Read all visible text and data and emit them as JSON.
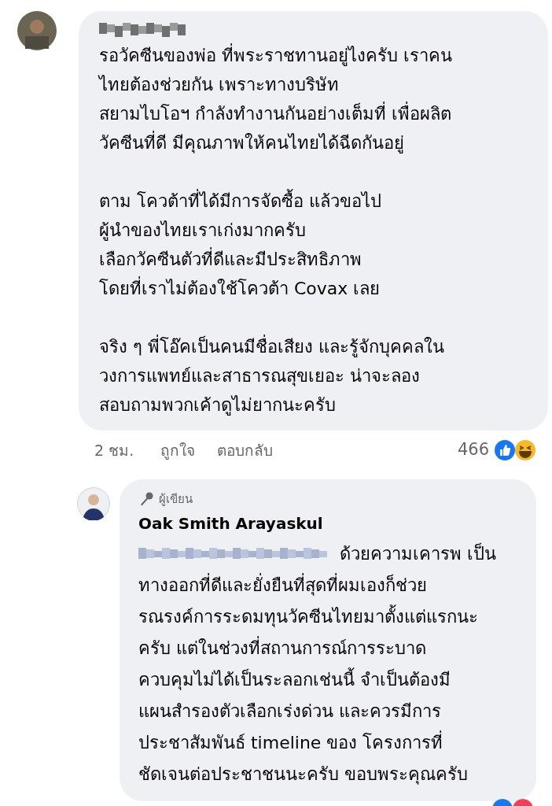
{
  "comment": {
    "paragraphs": [
      [
        "รอวัคซีนของพ่อ ที่พระราชทานอยู่ไงครับ เราคน",
        "ไทยต้องช่วยกัน เพราะทางบริษัท",
        "สยามไบโอฯ กำลังทำงานกันอย่างเต็มที่ เพื่อผลิต",
        "วัคซีนที่ดี มีคุณภาพให้คนไทยได้ฉีดกันอยู่"
      ],
      [
        "ตาม โควต้าที่ได้มีการจัดซื้อ แล้วขอไป",
        "ผู้นำของไทยเราเก่งมากครับ",
        "เลือกวัคซีนตัวที่ดีและมีประสิทธิภาพ",
        "โดยที่เราไม่ต้องใช้โควต้า Covax เลย"
      ],
      [
        "จริง ๆ พี่โอ๊คเป็นคนมีชื่อเสียง และรู้จักบุคคลใน",
        "วงการแพทย์และสาธารณสุขเยอะ น่าจะลอง",
        "สอบถามพวกเค้าดูไม่ยากนะครับ"
      ]
    ],
    "time": "2 ชม.",
    "actions": [
      "ถูกใจ",
      "ตอบกลับ"
    ],
    "reaction_count": "466"
  },
  "reply": {
    "badge": "ผู้เขียน",
    "author": "Oak Smith Arayaskul",
    "lines": [
      "ด้วยความเคารพ เป็น",
      "ทางออกที่ดีและยั่งยืนที่สุดที่ผมเองก็ช่วย",
      "รณรงค์การระดมทุนวัคซีนไทยมาตั้งแต่แรกนะ",
      "ครับ แต่ในช่วงที่สถานการณ์การระบาด",
      "ควบคุมไม่ได้เป็นระลอกเช่นนี้ จำเป็นต้องมี",
      "แผนสำรองตัวเลือกเร่งด่วน และควรมีการ",
      "ประชาสัมพันธ์ timeline ของ โครงการที่",
      "ชัดเจนต่อประชาชนนะครับ ขอบพระคุณครับ"
    ]
  }
}
